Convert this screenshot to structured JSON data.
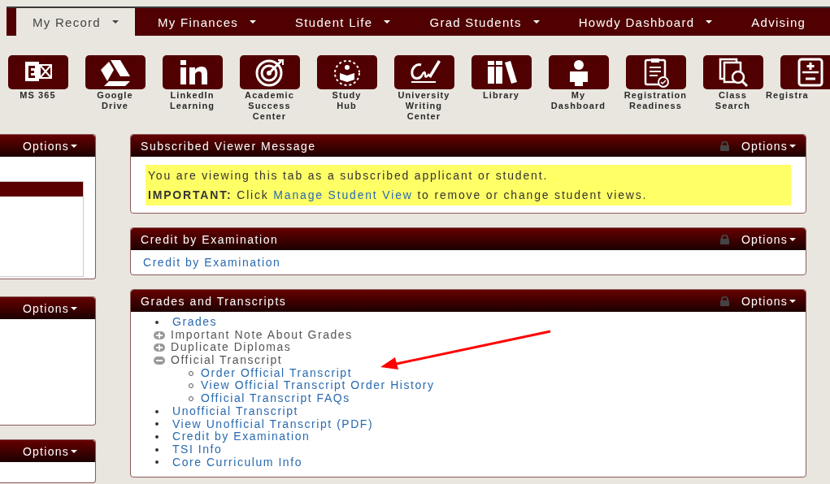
{
  "nav_tabs": [
    {
      "label": "My Record",
      "selected": true,
      "caret": true
    },
    {
      "label": "My Finances",
      "selected": false,
      "caret": true
    },
    {
      "label": "Student Life",
      "selected": false,
      "caret": true
    },
    {
      "label": "Grad Students",
      "selected": false,
      "caret": true
    },
    {
      "label": "Howdy Dashboard",
      "selected": false,
      "caret": true
    },
    {
      "label": "Advising",
      "selected": false,
      "caret": false
    }
  ],
  "launcher": [
    {
      "label": "MS 365"
    },
    {
      "label": "Google\nDrive"
    },
    {
      "label": "LinkedIn\nLearning"
    },
    {
      "label": "Academic\nSuccess\nCenter"
    },
    {
      "label": "Study\nHub"
    },
    {
      "label": "University\nWriting\nCenter"
    },
    {
      "label": "Library"
    },
    {
      "label": "My\nDashboard"
    },
    {
      "label": "Registration\nReadiness"
    },
    {
      "label": "Class\nSearch"
    },
    {
      "label": "Registra"
    }
  ],
  "left_panels": [
    {
      "options": "Options",
      "kind": "table"
    },
    {
      "options": "Options",
      "kind": "empty"
    },
    {
      "options": "Options",
      "kind": "empty"
    }
  ],
  "panels": [
    {
      "title": "Subscribed Viewer Message",
      "options": "Options",
      "locked": true,
      "kind": "message",
      "message": {
        "line_1": "You are viewing this tab as a subscribed applicant or student.",
        "line_2_before": "**IMPORTANT:** Click",
        "link": "Manage Student View",
        "line_2_after": "to remove or change student views."
      }
    },
    {
      "title": "Credit by Examination",
      "options": "Options",
      "locked": true,
      "kind": "links",
      "links": [
        "Credit by Examination"
      ]
    },
    {
      "title": "Grades and Transcripts",
      "options": "Options",
      "locked": true,
      "kind": "tree",
      "items": [
        {
          "label": "Grades",
          "kind": "link"
        },
        {
          "label": "Important Note About Grades",
          "kind": "toggle",
          "expanded": false
        },
        {
          "label": "Duplicate Diplomas",
          "kind": "toggle",
          "expanded": false
        },
        {
          "label": "Official Transcript",
          "kind": "toggle",
          "expanded": true,
          "children": [
            {
              "label": "Order Official Transcript",
              "kind": "link"
            },
            {
              "label": "View Official Transcript Order History",
              "kind": "link"
            },
            {
              "label": "Official Transcript FAQs",
              "kind": "link"
            }
          ]
        },
        {
          "label": "Unofficial Transcript",
          "kind": "link"
        },
        {
          "label": "View Unofficial Transcript (PDF)",
          "kind": "link"
        },
        {
          "label": "Credit by Examination",
          "kind": "link"
        },
        {
          "label": "TSI Info",
          "kind": "link"
        },
        {
          "label": "Core Curriculum Info",
          "kind": "link"
        }
      ],
      "annotation": {
        "kind": "arrow"
      }
    }
  ]
}
